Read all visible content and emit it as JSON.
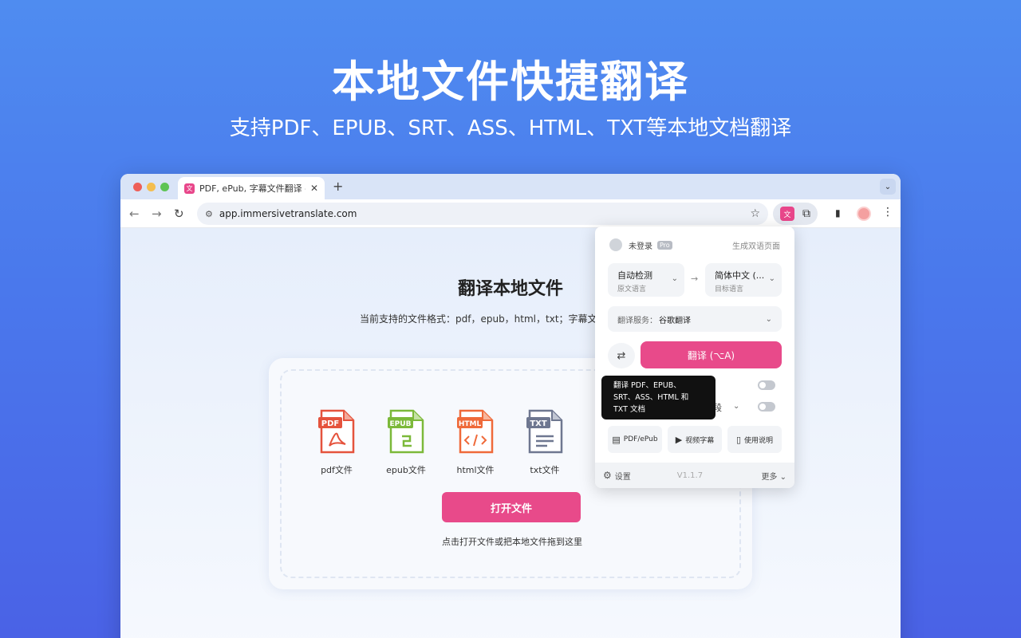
{
  "hero": {
    "title": "本地文件快捷翻译",
    "subtitle": "支持PDF、EPUB、SRT、ASS、HTML、TXT等本地文档翻译"
  },
  "browser": {
    "tab_title": "PDF, ePub, 字幕文件翻译 - 沉",
    "tab_close": "✕",
    "new_tab": "+",
    "url": "app.immersivetranslate.com"
  },
  "page": {
    "heading": "翻译本地文件",
    "description": "当前支持的文件格式：pdf，epub，html，txt；字幕文",
    "file_types": [
      {
        "badge": "PDF",
        "label": "pdf文件",
        "color": "#e5533d"
      },
      {
        "badge": "EPUB",
        "label": "epub文件",
        "color": "#7cb93a"
      },
      {
        "badge": "HTML",
        "label": "html文件",
        "color": "#ef6a3a"
      },
      {
        "badge": "TXT",
        "label": "txt文件",
        "color": "#6e7790"
      }
    ],
    "open_button": "打开文件",
    "drop_hint": "点击打开文件或把本地文件拖到这里"
  },
  "popup": {
    "login": "未登录",
    "pro_badge": "Pro",
    "bilingual": "生成双语页面",
    "source_lang": "自动检测",
    "source_lang_sub": "原文语言",
    "target_lang": "简体中文 (...",
    "target_lang_sub": "目标语言",
    "service_label": "翻译服务：",
    "service_value": "谷歌翻译",
    "translate_button": "翻译 (⌥A)",
    "paragraph_text": "段",
    "quick_pdf": "PDF/ePub",
    "quick_subtitle": "视频字幕",
    "quick_guide": "使用说明",
    "settings": "设置",
    "version": "V1.1.7",
    "more": "更多"
  },
  "tooltip": {
    "line1": "翻译 PDF、EPUB、",
    "line2": "SRT、ASS、HTML 和",
    "line3": "TXT 文档"
  },
  "colors": {
    "accent": "#e84a8a",
    "background_top": "#4f8cf0",
    "background_bottom": "#4a62e6"
  }
}
